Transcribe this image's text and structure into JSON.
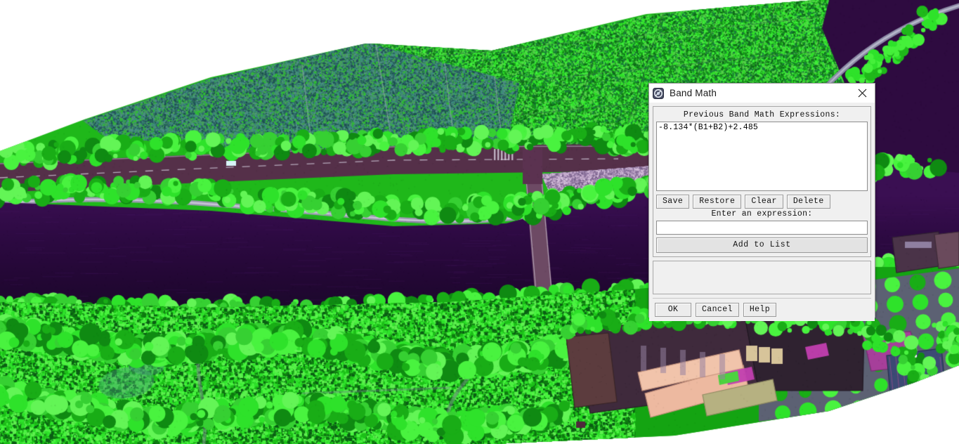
{
  "app": {
    "background_description": "false-color near-infrared drone orthomosaic of a river, roads, farmland and buildings"
  },
  "dialog": {
    "title": "Band Math",
    "icon": "envi-app-icon",
    "close_icon": "close-icon",
    "previous_label": "Previous Band Math Expressions:",
    "expressions": [
      "-8.134*(B1+B2)+2.485"
    ],
    "list_buttons": [
      {
        "name": "save-button",
        "label": "Save"
      },
      {
        "name": "restore-button",
        "label": "Restore"
      },
      {
        "name": "clear-button",
        "label": "Clear"
      },
      {
        "name": "delete-button",
        "label": "Delete"
      }
    ],
    "enter_label": "Enter an expression:",
    "expression_input_value": "",
    "expression_input_placeholder": "",
    "add_to_list_label": "Add to List",
    "status_text": "",
    "footer_buttons": [
      {
        "name": "ok-button",
        "label": "OK"
      },
      {
        "name": "cancel-button",
        "label": "Cancel"
      },
      {
        "name": "help-button",
        "label": "Help"
      }
    ]
  },
  "colors": {
    "dialog_face": "#f0f0f0",
    "titlebar": "#ffffff",
    "field_bg": "#ffffff",
    "border": "#9a9a9a",
    "vegetation_green": "#2de024",
    "water_purple": "#2d0a42",
    "road_mauve": "#6b4a63",
    "field_teal": "#3f7f82",
    "roof_pink": "#f0b49c",
    "roof_magenta": "#a6409a"
  }
}
